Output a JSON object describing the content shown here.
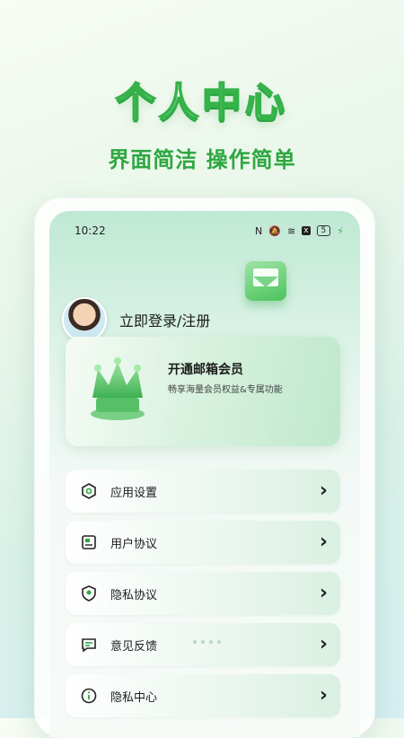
{
  "hero": {
    "title": "个人中心",
    "subtitle": "界面简洁 操作简单"
  },
  "status_bar": {
    "time": "10:22",
    "nfc": "N",
    "mute": "🔕",
    "wifi": "≋",
    "x_badge": "x",
    "battery": "5",
    "charging": "⚡"
  },
  "user": {
    "login_label": "立即登录/注册",
    "avatar_icon": "avatar"
  },
  "vip": {
    "title": "开通邮箱会员",
    "description": "畅享海量会员权益&专属功能",
    "icon": "crown-icon"
  },
  "menu": {
    "items": [
      {
        "label": "应用设置",
        "icon": "hexagon-settings-icon",
        "chevron": "›"
      },
      {
        "label": "用户协议",
        "icon": "document-icon",
        "chevron": "›"
      },
      {
        "label": "隐私协议",
        "icon": "shield-location-icon",
        "chevron": "›"
      },
      {
        "label": "意见反馈",
        "icon": "feedback-icon",
        "chevron": "›"
      },
      {
        "label": "隐私中心",
        "icon": "info-icon",
        "chevron": "›"
      }
    ]
  },
  "colors": {
    "brand_green": "#35b24a",
    "text_dark": "#1d1d1d"
  }
}
